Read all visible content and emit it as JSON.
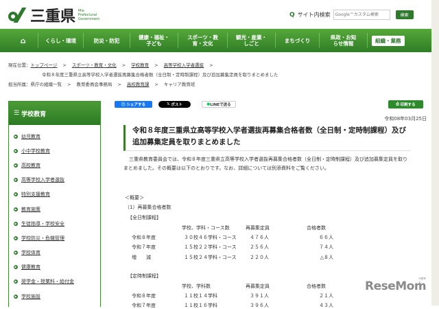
{
  "header": {
    "logo_text": "三重県",
    "logo_en": [
      "Mie",
      "Prefectural",
      "Government"
    ],
    "search_label": "サイト内検索",
    "search_placeholder": "Google™カスタム検索",
    "search_button": "検索"
  },
  "nav": [
    "くらし・環境",
    "防災・防犯",
    "健康・福祉・子ども",
    "スポーツ・教育・文化",
    "観光・産業・しごと",
    "まちづくり",
    "県政・お知らせ情報",
    "組織・業務"
  ],
  "breadcrumb": {
    "label": "現在位置：",
    "items": [
      "トップページ",
      "スポーツ・教育・文化",
      "学校教育",
      "高等学校入学者選抜"
    ],
    "current": "令和８年度三重県立高等学校入学者選抜再募集合格者数（全日制・定時制課程）及び追加募集定員を取りまとめました"
  },
  "department": {
    "label": "担当所属：",
    "items": [
      "県庁の組織一覧",
      "教育委員会事務局",
      "高校教育課",
      "キャリア教育班"
    ]
  },
  "sidebar": {
    "title": "学校教育",
    "items": [
      "幼児教育",
      "小中学校教育",
      "高校教育",
      "高等学校入学者選抜",
      "特別支援教育",
      "教育施策",
      "生徒指導・学校安全",
      "学校防災・危機管理",
      "学校体育",
      "健康教育",
      "奨学金・授業料・給付金",
      "学校施設"
    ]
  },
  "share": {
    "facebook": "シェアする",
    "x": "ポスト",
    "line": "LINEで送る",
    "print": "印刷する"
  },
  "article": {
    "date": "令和08年03月25日",
    "title": "令和８年度三重県立高等学校入学者選抜再募集合格者数（全日制・定時制課程）及び追加募集定員を取りまとめました",
    "body": "三重県教育委員会では、令和８年度三重県立高等学校入学者選抜再募集合格者数（全日制・定時制課程）及び追加募集定員を取りまとめました。その概要は以下のとおりです。なお、詳細については別添資料をご覧ください。",
    "overview": "＜概要＞",
    "section1": "（1）再募集合格者数",
    "fulltime": {
      "label": "【全日制課程】",
      "headers": [
        "学校、学科・コース数",
        "再募集定員",
        "合格者数"
      ],
      "rows": [
        [
          "令和８年度",
          "３０校４６学科・コース",
          "４７６人",
          "６６人"
        ],
        [
          "令和７年度",
          "１５校２２学科・コース",
          "２５６人",
          "７４人"
        ],
        [
          "増　　減",
          "１５校２４学科・コース",
          "２２０人",
          "△８人"
        ]
      ]
    },
    "parttime": {
      "label": "【定時制課程】",
      "headers": [
        "学校、学科数",
        "再募集定員",
        "合格者数"
      ],
      "rows": [
        [
          "令和８年度",
          "１１校１４学科",
          "３９１人",
          "２１人"
        ],
        [
          "令和７年度",
          "１１校１６学科",
          "３９６人",
          "４３人"
        ]
      ]
    }
  },
  "watermark": {
    "text": "ReseMom",
    "sub": "リセマム"
  },
  "colors": {
    "green": "#2d7a2d",
    "facebook": "#1877f2"
  }
}
